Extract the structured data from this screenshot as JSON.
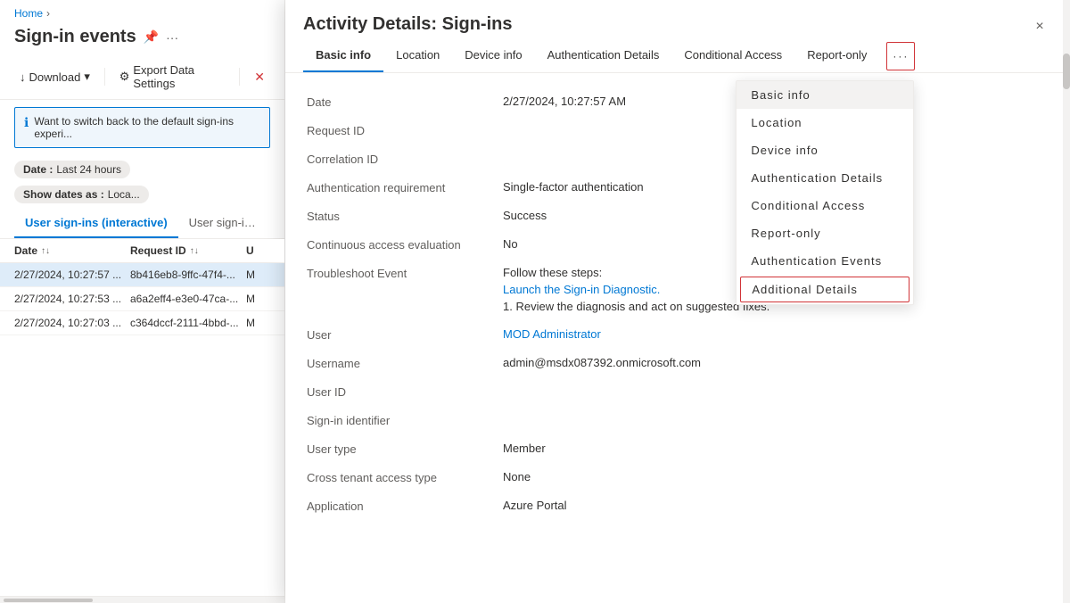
{
  "breadcrumb": {
    "home": "Home",
    "separator": "›"
  },
  "left": {
    "page_title": "Sign-in events",
    "toolbar": {
      "download": "Download",
      "export": "Export Data Settings",
      "download_arrow": "▾"
    },
    "info_banner": "Want to switch back to the default sign-ins experi...",
    "filters": [
      {
        "label": "Date",
        "value": "Last 24 hours"
      },
      {
        "label": "Show dates as",
        "value": "Loca..."
      }
    ],
    "tabs": [
      {
        "label": "User sign-ins (interactive)",
        "active": true
      },
      {
        "label": "User sign-ins (non...",
        "active": false
      }
    ],
    "table": {
      "columns": [
        "Date",
        "Request ID",
        "U"
      ],
      "rows": [
        {
          "date": "2/27/2024, 10:27:57 ...",
          "reqid": "8b416eb8-9ffc-47f4-...",
          "user": "M",
          "selected": true
        },
        {
          "date": "2/27/2024, 10:27:53 ...",
          "reqid": "a6a2eff4-e3e0-47ca-...",
          "user": "M",
          "selected": false
        },
        {
          "date": "2/27/2024, 10:27:03 ...",
          "reqid": "c364dccf-2111-4bbd-...",
          "user": "M",
          "selected": false
        }
      ]
    }
  },
  "modal": {
    "title": "Activity Details: Sign-ins",
    "close_label": "×",
    "tabs": [
      {
        "label": "Basic info",
        "active": true
      },
      {
        "label": "Location",
        "active": false
      },
      {
        "label": "Device info",
        "active": false
      },
      {
        "label": "Authentication Details",
        "active": false
      },
      {
        "label": "Conditional Access",
        "active": false
      },
      {
        "label": "Report-only",
        "active": false
      }
    ],
    "more_button": "···",
    "dropdown": {
      "items": [
        {
          "label": "Basic info",
          "highlighted_bg": true
        },
        {
          "label": "Location"
        },
        {
          "label": "Device info"
        },
        {
          "label": "Authentication Details"
        },
        {
          "label": "Conditional Access"
        },
        {
          "label": "Report-only"
        },
        {
          "label": "Authentication Events"
        },
        {
          "label": "Additional Details",
          "bordered": true
        }
      ]
    },
    "details": [
      {
        "label": "Date",
        "value": "2/27/2024, 10:27:57 AM",
        "type": "text"
      },
      {
        "label": "Request ID",
        "value": "",
        "type": "text"
      },
      {
        "label": "Correlation ID",
        "value": "",
        "type": "text"
      },
      {
        "label": "Authentication requirement",
        "value": "Single-factor authentication",
        "type": "text"
      },
      {
        "label": "Status",
        "value": "Success",
        "type": "text"
      },
      {
        "label": "Continuous access evaluation",
        "value": "No",
        "type": "text"
      },
      {
        "label": "Troubleshoot Event",
        "value": "",
        "type": "troubleshoot",
        "troubleshoot": {
          "intro": "Follow these steps:",
          "link": "Launch the Sign-in Diagnostic.",
          "step": "1. Review the diagnosis and act on suggested fixes."
        }
      },
      {
        "label": "User",
        "value": "MOD Administrator",
        "type": "link"
      },
      {
        "label": "Username",
        "value": "admin@msdx087392.onmicrosoft.com",
        "type": "text"
      },
      {
        "label": "User ID",
        "value": "",
        "type": "text"
      },
      {
        "label": "Sign-in identifier",
        "value": "",
        "type": "text"
      },
      {
        "label": "User type",
        "value": "Member",
        "type": "text"
      },
      {
        "label": "Cross tenant access type",
        "value": "None",
        "type": "text"
      },
      {
        "label": "Application",
        "value": "Azure Portal",
        "type": "text"
      }
    ]
  }
}
